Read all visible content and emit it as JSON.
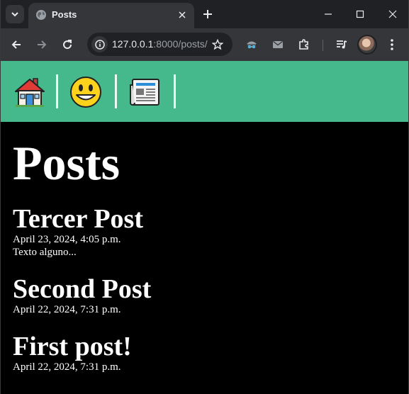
{
  "browser": {
    "tab": {
      "title": "Posts"
    },
    "address_bar": {
      "host": "127.0.0.1",
      "rest": ":8000/posts/"
    }
  },
  "page": {
    "nav_icons": [
      "house-icon",
      "smiley-face-icon",
      "newspaper-icon"
    ],
    "heading": "Posts",
    "posts": [
      {
        "title": "Tercer Post",
        "date": "April 23, 2024, 4:05 p.m.",
        "body": "Texto alguno..."
      },
      {
        "title": "Second Post",
        "date": "April 22, 2024, 7:31 p.m.",
        "body": ""
      },
      {
        "title": "First post!",
        "date": "April 22, 2024, 7:31 p.m.",
        "body": ""
      }
    ]
  },
  "colors": {
    "tabstrip": "#202124",
    "toolbar": "#35363a",
    "navbar": "#45b98c",
    "page_background": "#000000",
    "text": "#ffffff"
  }
}
